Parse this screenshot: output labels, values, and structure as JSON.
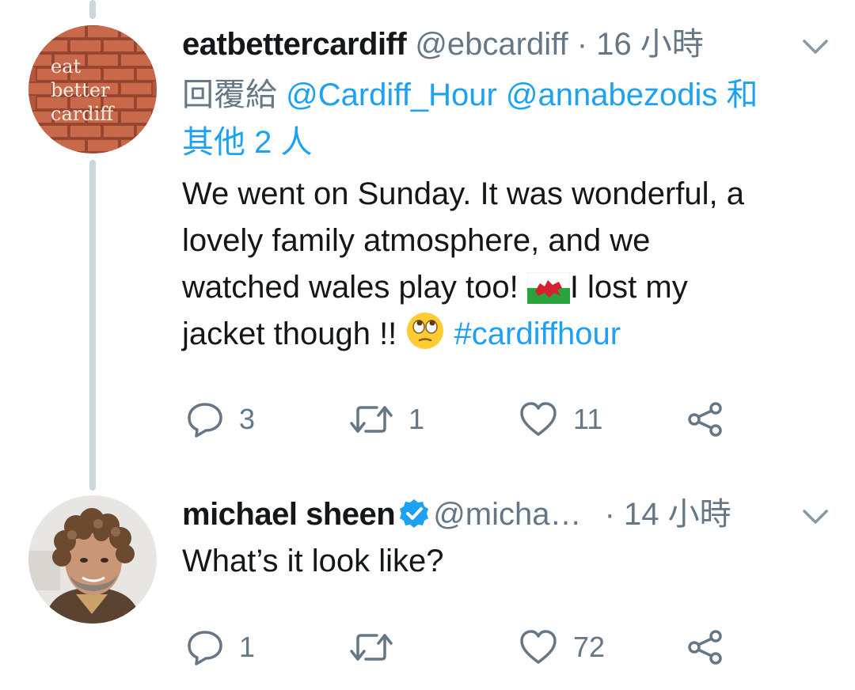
{
  "tweets": [
    {
      "display_name": "eatbettercardiff",
      "handle": "@ebcardiff",
      "time": "· 16 小時",
      "avatar_text": [
        "eat",
        "better",
        "cardiff"
      ],
      "reply_prefix": "回覆給",
      "reply_mentions": "@Cardiff_Hour @annabezodis",
      "reply_and": "和",
      "reply_others": "其他 2 人",
      "body_lines": [
        "We went on Sunday. It was wonderful, a",
        "lovely family atmosphere, and we",
        "watched wales play too!",
        "I lost my",
        "jacket though !!"
      ],
      "hashtag": "#cardiffhour",
      "stats": {
        "replies": "3",
        "retweets": "1",
        "likes": "11"
      }
    },
    {
      "display_name": "michael sheen",
      "handle": "@micha…",
      "time": "· 14 小時",
      "verified": true,
      "body": "What’s it look like?",
      "stats": {
        "replies": "1",
        "retweets": "",
        "likes": "72"
      }
    }
  ],
  "colors": {
    "link": "#1da1f2",
    "muted": "#657786",
    "thread_line": "#ccd6dd",
    "brick": "#b3563c"
  },
  "icons": [
    "chevron-down-icon",
    "reply-icon",
    "retweet-icon",
    "like-icon",
    "share-icon",
    "verified-badge-icon",
    "wales-flag-emoji",
    "eye-roll-emoji"
  ]
}
